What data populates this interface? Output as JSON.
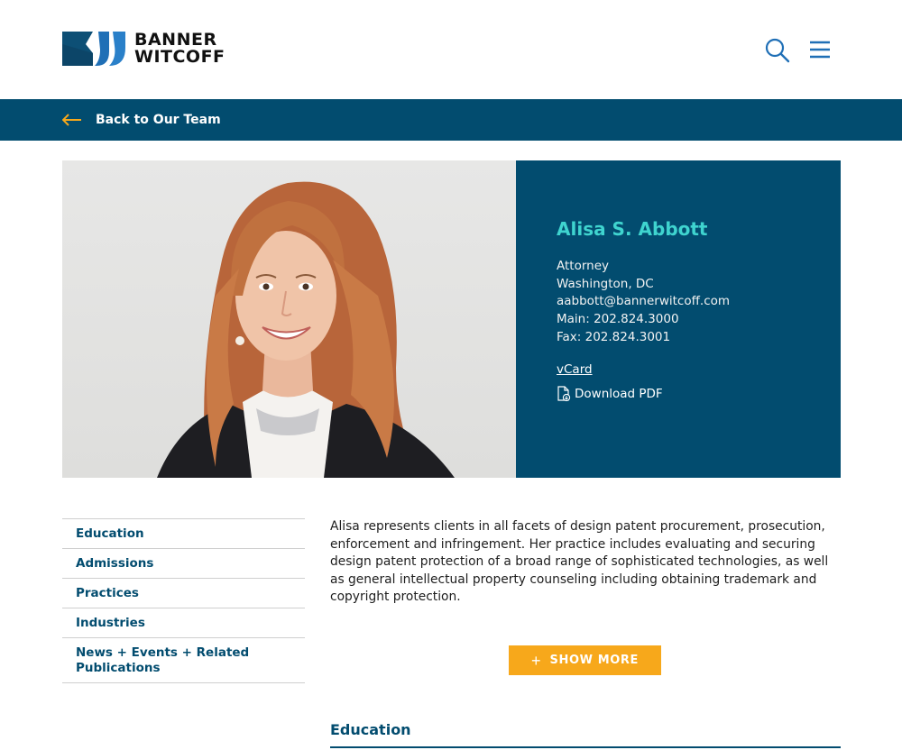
{
  "header": {
    "logo_line1": "BANNER",
    "logo_line2": "WITCOFF",
    "search_icon": "search-icon",
    "menu_icon": "hamburger-menu-icon",
    "brand_color": "#024c6f",
    "logo_color": "#1a5a9a"
  },
  "backbar": {
    "label": "Back to Our Team",
    "arrow_icon": "arrow-left-icon",
    "arrow_color": "#f7a81b"
  },
  "profile": {
    "name": "Alisa S. Abbott",
    "title": "Attorney",
    "location": "Washington, DC",
    "email": "aabbott@bannerwitcoff.com",
    "main_phone": "Main: 202.824.3000",
    "fax": "Fax: 202.824.3001",
    "vcard_label": "vCard",
    "pdf_label": "Download PDF",
    "pdf_icon": "file-download-icon",
    "name_color": "#3fd4cf"
  },
  "sidenav": {
    "items": [
      {
        "label": "Education"
      },
      {
        "label": "Admissions"
      },
      {
        "label": "Practices"
      },
      {
        "label": "Industries"
      },
      {
        "label": "News + Events + Related Publications"
      }
    ]
  },
  "bio": {
    "text": "Alisa represents clients in all facets of design patent procurement, prosecution, enforcement and infringement. Her practice includes evaluating and securing design patent protection of a broad range of sophisticated technologies, as well as general intellectual property counseling including obtaining trademark and copyright protection.",
    "show_more_label": "SHOW MORE",
    "accent_color": "#f7a81b"
  },
  "education": {
    "heading": "Education"
  }
}
